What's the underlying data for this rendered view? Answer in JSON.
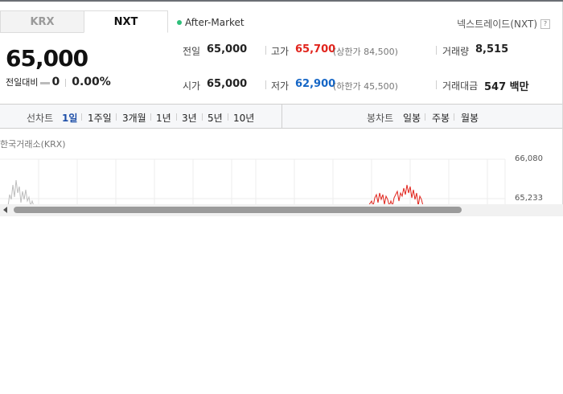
{
  "tabs": [
    {
      "label": "KRX",
      "active": false
    },
    {
      "label": "NXT",
      "active": true
    }
  ],
  "session": {
    "label": "After-Market",
    "dot_color": "#2ebf7a"
  },
  "nxt_link": {
    "label": "넥스트레이드(NXT)",
    "help_icon": "question-icon",
    "help_glyph": "?"
  },
  "quote": {
    "price": "65,000",
    "change_label": "전일대비",
    "change_value": "0",
    "change_rate": "0.00%"
  },
  "stats": {
    "prev_close": {
      "label": "전일",
      "value": "65,000"
    },
    "high": {
      "label": "고가",
      "value": "65,700",
      "sub": "(상한가 84,500)"
    },
    "volume": {
      "label": "거래량",
      "value": "8,515"
    },
    "open": {
      "label": "시가",
      "value": "65,000"
    },
    "low": {
      "label": "저가",
      "value": "62,900",
      "sub": "(하한가 45,500)"
    },
    "amount": {
      "label": "거래대금",
      "value": "547 백만"
    }
  },
  "line_chart_periods": {
    "title": "선차트",
    "items": [
      "1일",
      "1주일",
      "3개월",
      "1년",
      "3년",
      "5년",
      "10년"
    ],
    "active": "1일"
  },
  "candle_chart_periods": {
    "title": "봉차트",
    "items": [
      "일봉",
      "주봉",
      "월봉"
    ]
  },
  "chart": {
    "exchange_label": "한국거래소(KRX)",
    "y_ticks": [
      "66,080",
      "65,233"
    ],
    "colors": {
      "up": "#e1241c",
      "neutral": "#bdbdbd",
      "grid": "#ececec"
    }
  }
}
